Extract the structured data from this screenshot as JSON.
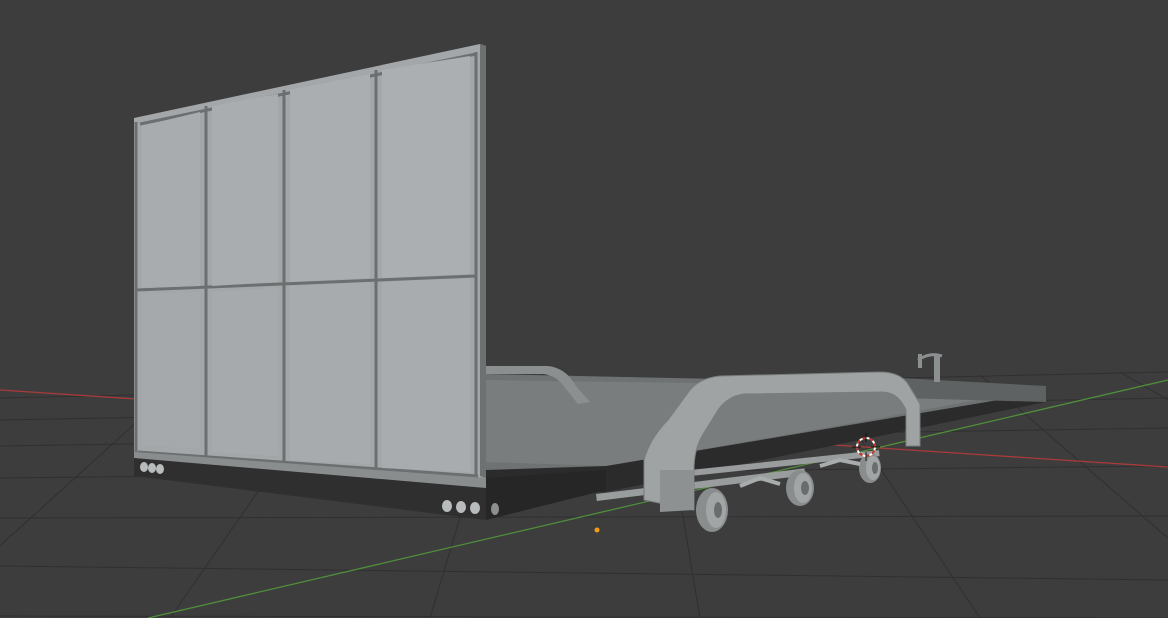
{
  "viewport": {
    "background_color": "#3d3d3d",
    "grid_line_color": "#2f2f2f",
    "x_axis_color": "#a83a3a",
    "y_axis_color": "#4f8f3a"
  },
  "scene": {
    "object": "flatbed-trailer",
    "panel_color": "#9ea2a4",
    "body_color": "#7f8283",
    "dark_color": "#2c2c2c",
    "light_color": "#b8bbbc",
    "wheel_count": 3,
    "headboard_columns": 4,
    "headboard_rows": 2
  },
  "overlays": {
    "cursor_3d_icon": "3d-cursor-icon",
    "origin_icon": "object-origin-icon"
  }
}
